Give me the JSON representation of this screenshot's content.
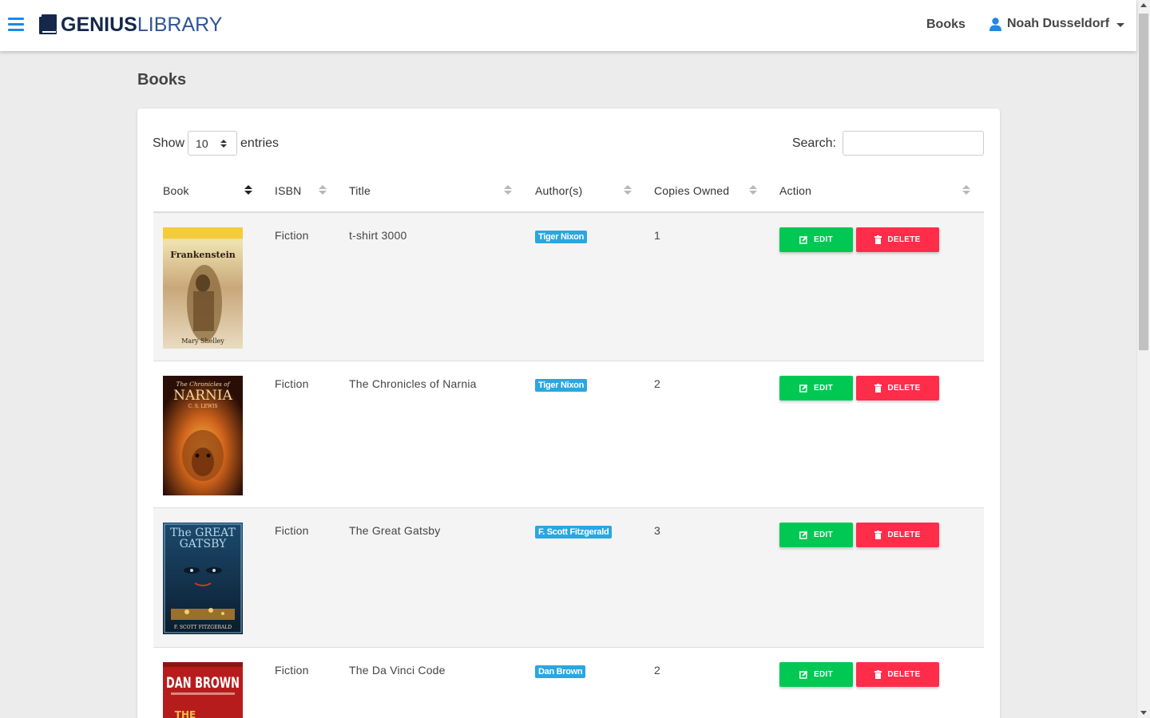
{
  "brand": {
    "bold": "GENIUS",
    "light": "LIBRARY"
  },
  "nav": {
    "books": "Books",
    "user": "Noah Dusseldorf"
  },
  "page": {
    "title": "Books"
  },
  "controls": {
    "show_label": "Show",
    "entries_value": "10",
    "entries_label": "entries",
    "search_label": "Search:",
    "search_value": ""
  },
  "table": {
    "columns": [
      "Book",
      "ISBN",
      "Title",
      "Author(s)",
      "Copies Owned",
      "Action"
    ],
    "rows": [
      {
        "isbn": "Fiction",
        "title": "t-shirt 3000",
        "author": "Tiger Nixon",
        "copies": "1",
        "cover_lines": [
          "Frankenstein",
          "Mary Shelley"
        ]
      },
      {
        "isbn": "Fiction",
        "title": "The Chronicles of Narnia",
        "author": "Tiger Nixon",
        "copies": "2",
        "cover_lines": [
          "The Chronicles of",
          "NARNIA",
          "C. S. LEWIS"
        ]
      },
      {
        "isbn": "Fiction",
        "title": "The Great Gatsby",
        "author": "F. Scott Fitzgerald",
        "copies": "3",
        "cover_lines": [
          "The GREAT",
          "GATSBY",
          "F. SCOTT FITZGERALD"
        ]
      },
      {
        "isbn": "Fiction",
        "title": "The Da Vinci Code",
        "author": "Dan Brown",
        "copies": "2",
        "cover_lines": [
          "DAN BROWN",
          "THE"
        ]
      }
    ],
    "edit_label": "EDIT",
    "delete_label": "DELETE"
  }
}
